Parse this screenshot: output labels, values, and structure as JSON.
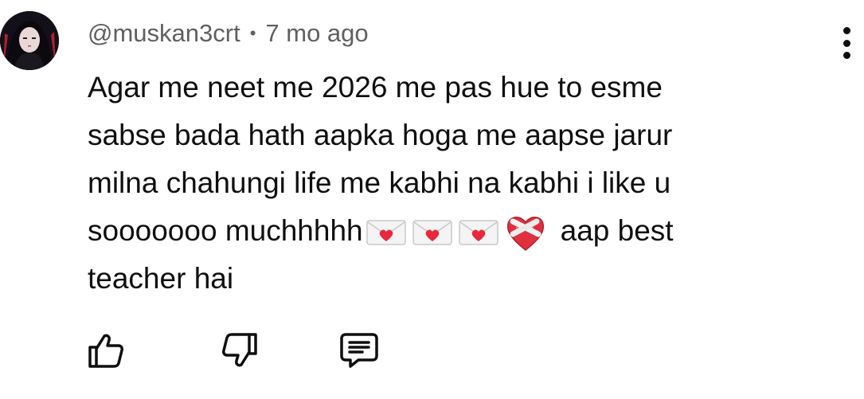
{
  "comment": {
    "author": "@muskan3crt",
    "separator": "•",
    "timestamp": "7 mo ago",
    "lines": [
      "Agar me neet me 2026 me pas hue to esme",
      "sabse bada hath aapka hoga  me aapse jarur",
      "milna chahungi life me kabhi na kabhi i like u",
      "sooooooo muchhhhh",
      "teacher hai"
    ],
    "line4_tail": "aap best",
    "emojis": [
      "love-letter-icon",
      "love-letter-icon",
      "love-letter-icon",
      "mending-heart-icon"
    ]
  },
  "actions": {
    "icons": [
      "thumbs-up-icon",
      "thumbs-down-icon",
      "reply-icon"
    ]
  },
  "colors": {
    "text": "#0f0f0f",
    "meta": "#606060",
    "heart": "#e8283c"
  }
}
